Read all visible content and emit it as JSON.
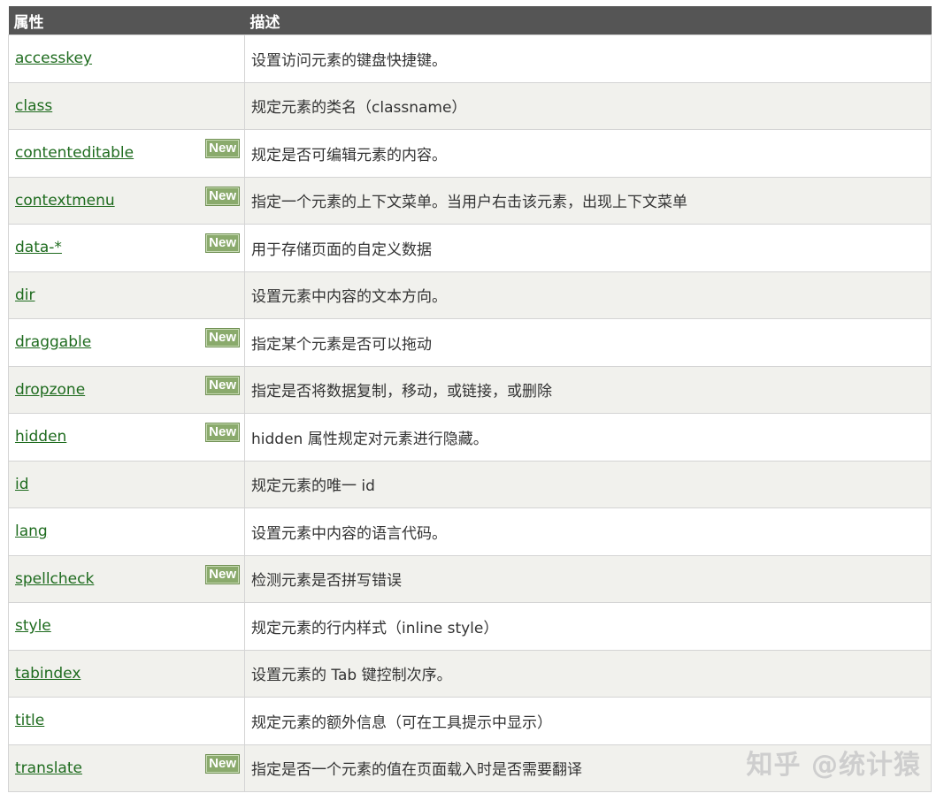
{
  "table": {
    "headers": {
      "attr": "属性",
      "desc": "描述"
    },
    "new_label": "New",
    "rows": [
      {
        "attr": "accesskey",
        "desc": "设置访问元素的键盘快捷键。",
        "new": false
      },
      {
        "attr": "class",
        "desc": "规定元素的类名（classname）",
        "new": false
      },
      {
        "attr": "contenteditable",
        "desc": "规定是否可编辑元素的内容。",
        "new": true
      },
      {
        "attr": "contextmenu",
        "desc": "指定一个元素的上下文菜单。当用户右击该元素，出现上下文菜单",
        "new": true
      },
      {
        "attr": "data-*",
        "desc": "用于存储页面的自定义数据",
        "new": true
      },
      {
        "attr": "dir",
        "desc": "设置元素中内容的文本方向。",
        "new": false
      },
      {
        "attr": "draggable",
        "desc": "指定某个元素是否可以拖动",
        "new": true
      },
      {
        "attr": "dropzone",
        "desc": "指定是否将数据复制，移动，或链接，或删除",
        "new": true
      },
      {
        "attr": "hidden",
        "desc": "hidden 属性规定对元素进行隐藏。",
        "new": true
      },
      {
        "attr": "id",
        "desc": "规定元素的唯一 id",
        "new": false
      },
      {
        "attr": "lang",
        "desc": "设置元素中内容的语言代码。",
        "new": false
      },
      {
        "attr": "spellcheck",
        "desc": "检测元素是否拼写错误",
        "new": true
      },
      {
        "attr": "style",
        "desc": "规定元素的行内样式（inline style）",
        "new": false
      },
      {
        "attr": "tabindex",
        "desc": "设置元素的 Tab 键控制次序。",
        "new": false
      },
      {
        "attr": "title",
        "desc": "规定元素的额外信息（可在工具提示中显示）",
        "new": false
      },
      {
        "attr": "translate",
        "desc": "指定是否一个元素的值在页面载入时是否需要翻译",
        "new": true
      }
    ]
  },
  "watermark": "知乎 @统计猿",
  "colors": {
    "header_bg": "#555555",
    "link": "#1e6b1e",
    "new_badge": "#8aaa6c",
    "alt_row": "#f1f1ed"
  }
}
